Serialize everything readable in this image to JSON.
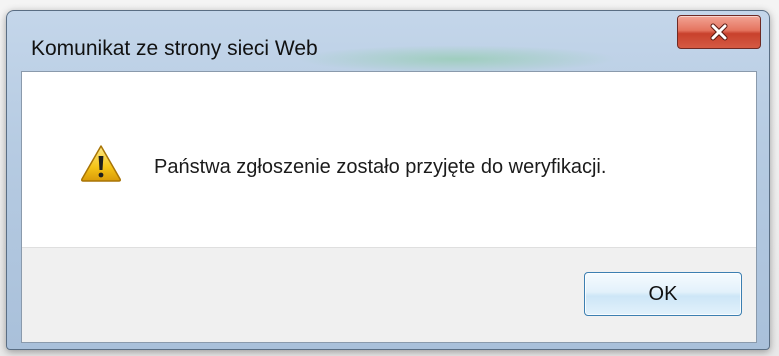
{
  "dialog": {
    "title": "Komunikat ze strony sieci Web",
    "message": "Państwa zgłoszenie zostało przyjęte do weryfikacji.",
    "icon": "warning-icon",
    "ok_label": "OK",
    "close_icon": "close-icon"
  },
  "colors": {
    "title_bar": "#b6cbe2",
    "close_button": "#d55a43",
    "ok_button_border": "#3c7fb1",
    "warning_fill": "#f5c417"
  }
}
